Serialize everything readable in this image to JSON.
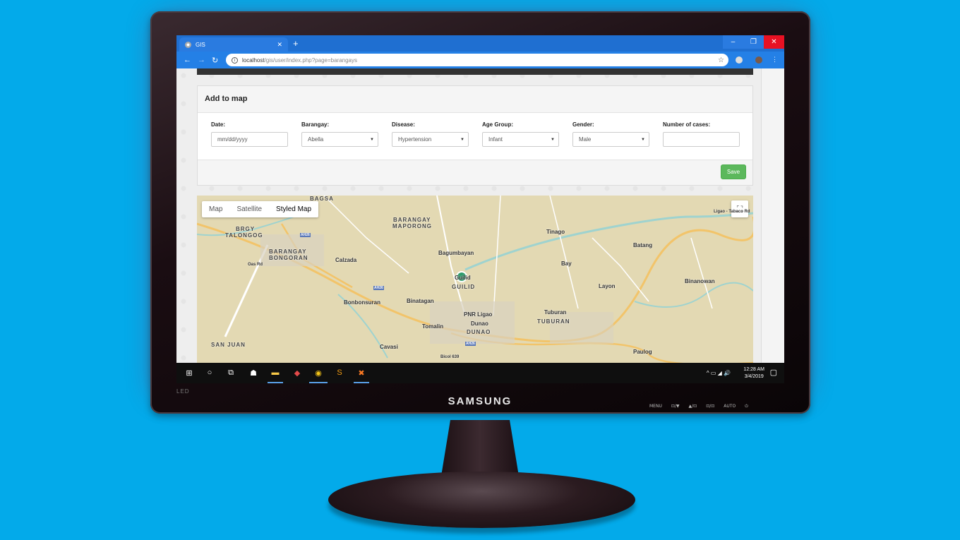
{
  "monitor": {
    "brand": "SAMSUNG",
    "badge": "LED",
    "controls": [
      "MENU",
      "⊡/▼",
      "▲/⊡",
      "⊡/⊡",
      "AUTO",
      "⏻"
    ]
  },
  "browser": {
    "tab_title": "GIS",
    "url_host": "localhost",
    "url_path": "/gis/user/index.php?page=barangays",
    "new_tab": "+",
    "win_min": "–",
    "win_restore": "❐",
    "win_close": "✕"
  },
  "panel": {
    "title": "Add to map",
    "fields": [
      {
        "label": "Date:",
        "value": "mm/dd/yyyy",
        "type": "input"
      },
      {
        "label": "Barangay:",
        "value": "Abella",
        "type": "select"
      },
      {
        "label": "Disease:",
        "value": "Hypertension",
        "type": "select"
      },
      {
        "label": "Age Group:",
        "value": "Infant",
        "type": "select"
      },
      {
        "label": "Gender:",
        "value": "Male",
        "type": "select"
      },
      {
        "label": "Number of cases:",
        "value": "",
        "type": "input"
      }
    ],
    "save_label": "Save"
  },
  "map": {
    "types": [
      "Map",
      "Satellite",
      "Styled Map"
    ],
    "active_type": "Styled Map",
    "places": [
      "BAGSA",
      "BRGY",
      "TALONGOG",
      "BARANGAY",
      "MAPORONG",
      "Tinago",
      "Ligao - Tabaco Rd",
      "BARANGAY",
      "BONGORAN",
      "Bagumbayan",
      "Batang",
      "Calzada",
      "Bay",
      "Oas Rd",
      "Guilid",
      "GUILID",
      "Layon",
      "Binanowan",
      "Bonbonsuran",
      "Binatagan",
      "PNR Ligao",
      "Tuburan",
      "TUBURAN",
      "Tomalin",
      "Dunao",
      "DUNAO",
      "SAN JUAN",
      "Cavasi",
      "Paulog",
      "AH26",
      "AH26",
      "AH26",
      "Bicol 639"
    ]
  },
  "taskbar": {
    "time": "12:28 AM",
    "date": "3/4/2019"
  }
}
